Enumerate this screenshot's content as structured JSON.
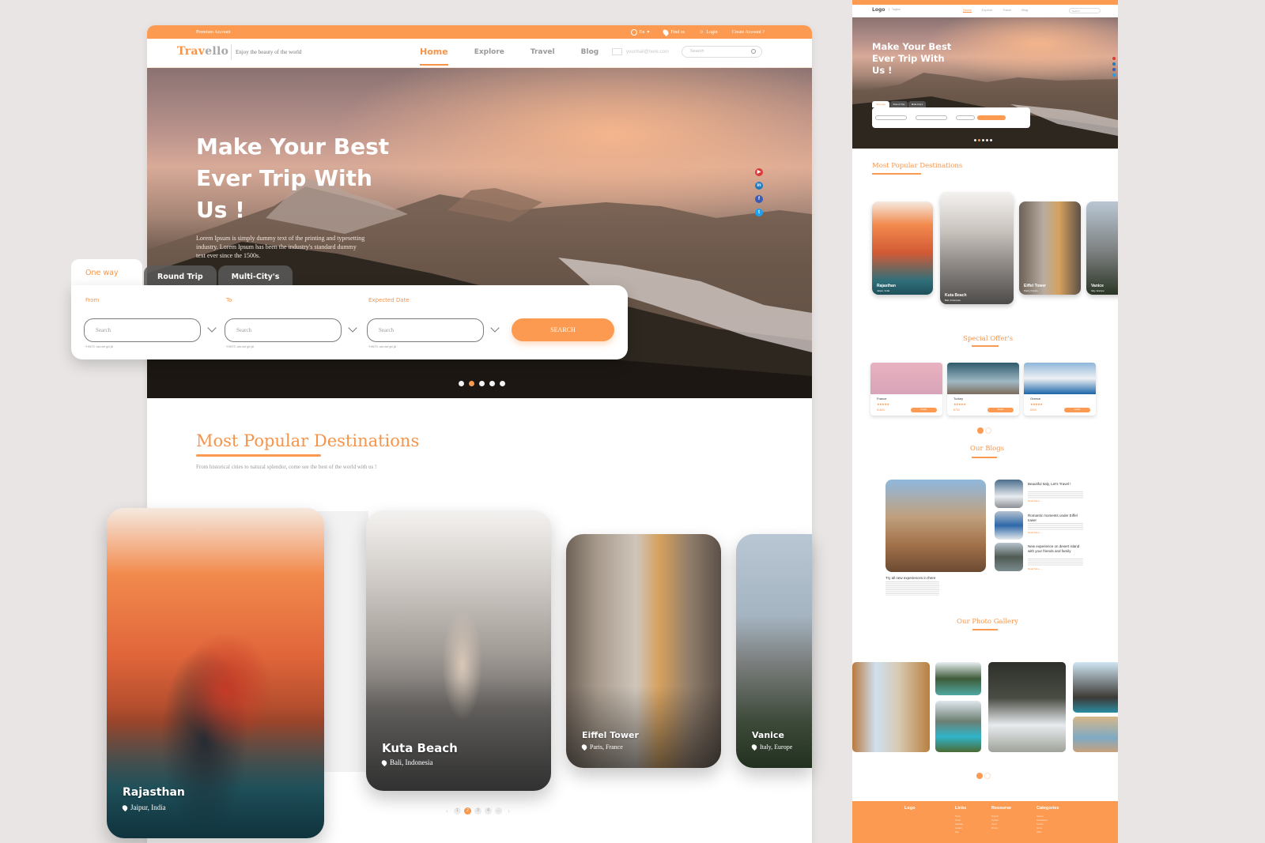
{
  "topbar": {
    "premium_label": "Premium Account",
    "language": "En",
    "find_us": "Find us",
    "login": "Login",
    "create_account": "Create Account ?"
  },
  "brand": {
    "logo_part1": "Trav",
    "logo_part2": "ello",
    "tagline": "Enjoy the beauty of the world"
  },
  "nav": {
    "items": [
      {
        "label": "Home",
        "active": true
      },
      {
        "label": "Explore",
        "active": false
      },
      {
        "label": "Travel",
        "active": false
      },
      {
        "label": "Blog",
        "active": false
      }
    ],
    "email_placeholder": "yourmail@here.com",
    "search_placeholder": "Search"
  },
  "hero": {
    "title": "Make Your Best Ever Trip With Us !",
    "description": "Lorem Ipsum is simply dummy text of the printing and typesetting industry. Lorem Ipsum has been the industry's standard dummy text ever since the 1500s.",
    "social": [
      {
        "name": "youtube",
        "color": "#d93b3b",
        "glyph": "▶"
      },
      {
        "name": "linkedin",
        "color": "#1f7bbf",
        "glyph": "in"
      },
      {
        "name": "facebook",
        "color": "#3b5bb5",
        "glyph": "f"
      },
      {
        "name": "twitter",
        "color": "#1da1f2",
        "glyph": "t"
      }
    ],
    "slide_count": 5,
    "active_slide": 2
  },
  "search_panel": {
    "tabs": [
      {
        "label": "One way",
        "active": true
      },
      {
        "label": "Round Trip",
        "active": false
      },
      {
        "label": "Multi-City's",
        "active": false
      }
    ],
    "fields": [
      {
        "label": "From",
        "placeholder": "Search",
        "hint": "*HINTS: abc def ghi jkl"
      },
      {
        "label": "To",
        "placeholder": "Search",
        "hint": "*HINTS: abc def ghi jkl"
      },
      {
        "label": "Expected Date",
        "placeholder": "Search",
        "hint": "*HINTS: abc def ghi jkl"
      }
    ],
    "submit_label": "SEARCH"
  },
  "popular": {
    "title": "Most Popular Destinations",
    "subtitle": "From historical cities to natural splendor, come see the best of the world with us !",
    "cards": [
      {
        "name": "Rajasthan",
        "location": "Jaipur, India"
      },
      {
        "name": "Kuta Beach",
        "location": "Bali, Indonesia"
      },
      {
        "name": "Eiffel Tower",
        "location": "Paris, France"
      },
      {
        "name": "Vanice",
        "location": "Italy, Europe"
      }
    ],
    "pagination": {
      "pages": [
        "1",
        "2",
        "3",
        "4",
        "..."
      ],
      "active_page": "2",
      "prev": "‹",
      "next": "›"
    }
  },
  "mobile_preview": {
    "logo": "Logo",
    "tagline": "Tagline",
    "nav": [
      "Home",
      "Explore",
      "Travel",
      "Blog"
    ],
    "search_placeholder": "Search",
    "hero_title": "Make Your Best Ever Trip With Us !",
    "mini_tabs": [
      "One way",
      "Round Trip",
      "Multi-City's"
    ],
    "popular_title": "Most Popular Destinations",
    "popular_cards": [
      {
        "name": "Rajasthan",
        "location": "Jaipur, India"
      },
      {
        "name": "Kuta Beach",
        "location": "Bali, Indonesia"
      },
      {
        "name": "Eiffel Tower",
        "location": "Paris, France"
      },
      {
        "name": "Vanice",
        "location": "Italy, Europe"
      }
    ],
    "offers_title": "Special Offer's",
    "offers": [
      {
        "country": "France",
        "price": "$1800",
        "from": "from",
        "button": "Details"
      },
      {
        "country": "Turkey",
        "price": "$700",
        "from": "from",
        "button": "Details"
      },
      {
        "country": "Greece",
        "price": "$900",
        "from": "from",
        "button": "Details"
      }
    ],
    "blogs_title": "Our Blogs",
    "blog_main_title": "Try all new experiences in there",
    "blog_posts": [
      {
        "title": "Beautiful Italy, Let's Travel !",
        "read_more": "Read More →"
      },
      {
        "title": "Romantic moments under Eiffel tower",
        "read_more": "Read More →"
      },
      {
        "title": "New experience on desert island with your friends and family",
        "read_more": "Read More →"
      }
    ],
    "gallery_title": "Our Photo Gallery",
    "footer": {
      "columns": [
        "Logo",
        "Links",
        "Resourse",
        "Categories"
      ],
      "links": [
        "Home",
        "Travel",
        "Calendar",
        "Contact",
        "Faq"
      ],
      "resources": [
        "Support",
        "Contact",
        "Terms",
        "Privacy"
      ],
      "categories": [
        "Support",
        "Destinations",
        "Contact",
        "Terms",
        "Offers"
      ]
    }
  }
}
